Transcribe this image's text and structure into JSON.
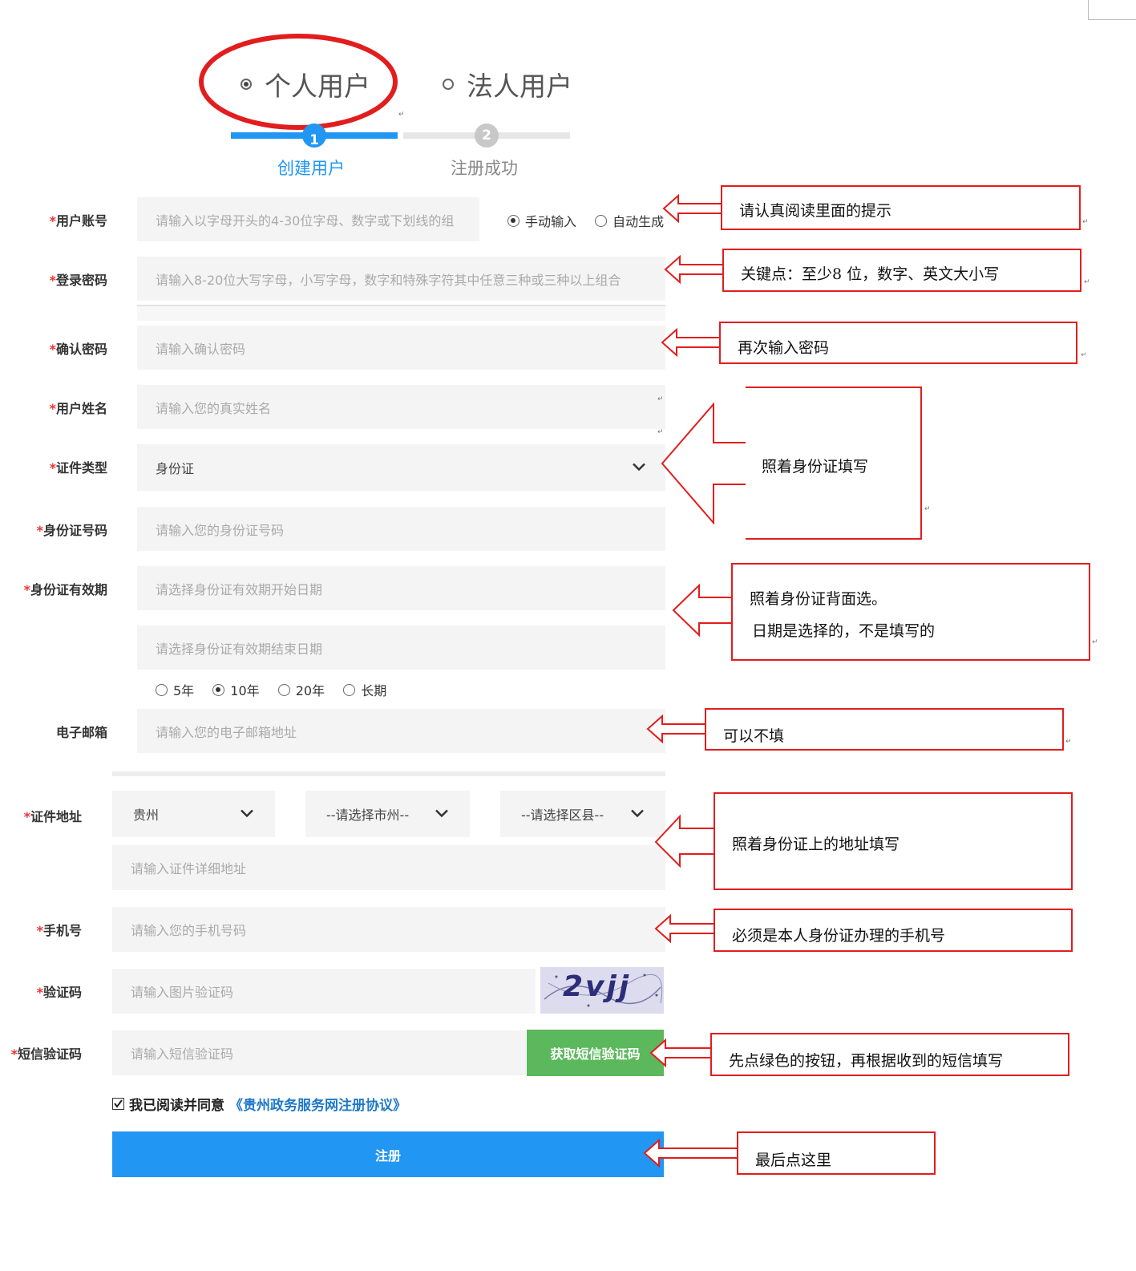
{
  "user_types": [
    {
      "label": "个人用户",
      "selected": true
    },
    {
      "label": "法人用户",
      "selected": false
    }
  ],
  "steps": [
    {
      "number": "1",
      "label": "创建用户",
      "active": true
    },
    {
      "number": "2",
      "label": "注册成功",
      "active": false
    }
  ],
  "form": {
    "account": {
      "label": "用户账号",
      "placeholder": "请输入以字母开头的4-30位字母、数字或下划线的组",
      "modes": [
        {
          "label": "手动输入",
          "selected": true
        },
        {
          "label": "自动生成",
          "selected": false
        }
      ]
    },
    "password": {
      "label": "登录密码",
      "placeholder": "请输入8-20位大写字母，小写字母，数字和特殊字符其中任意三种或三种以上组合"
    },
    "confirm": {
      "label": "确认密码",
      "placeholder": "请输入确认密码"
    },
    "name": {
      "label": "用户姓名",
      "placeholder": "请输入您的真实姓名"
    },
    "id_type": {
      "label": "证件类型",
      "value": "身份证"
    },
    "id_number": {
      "label": "身份证号码",
      "placeholder": "请输入您的身份证号码"
    },
    "validity": {
      "label": "身份证有效期",
      "start_placeholder": "请选择身份证有效期开始日期",
      "end_placeholder": "请选择身份证有效期结束日期",
      "options": [
        {
          "label": "5年",
          "selected": false
        },
        {
          "label": "10年",
          "selected": true
        },
        {
          "label": "20年",
          "selected": false
        },
        {
          "label": "长期",
          "selected": false
        }
      ]
    },
    "email": {
      "label": "电子邮箱",
      "placeholder": "请输入您的电子邮箱地址"
    },
    "address": {
      "label": "证件地址",
      "province": "贵州",
      "city": "--请选择市州--",
      "district": "--请选择区县--",
      "detail_placeholder": "请输入证件详细地址"
    },
    "phone": {
      "label": "手机号",
      "placeholder": "请输入您的手机号码"
    },
    "captcha": {
      "label": "验证码",
      "placeholder": "请输入图片验证码",
      "image_text": "2vjj"
    },
    "sms": {
      "label": "短信验证码",
      "placeholder": "请输入短信验证码",
      "button": "获取短信验证码"
    },
    "agreement": {
      "text": "我已阅读并同意",
      "link": "《贵州政务服务网注册协议》",
      "checked": true
    },
    "submit": "注册"
  },
  "annotations": [
    "请认真阅读里面的提示",
    "关键点：至少8 位，数字、英文大小写",
    "再次输入密码",
    "照着身份证填写",
    "照着身份证背面选。",
    "日期是选择的，不是填写的",
    "可以不填",
    "照着身份证上的地址填写",
    "必须是本人身份证办理的手机号",
    "先点绿色的按钮，再根据收到的短信填写",
    "最后点这里"
  ],
  "colors": {
    "annotation_red": "#e21d1d",
    "step_blue": "#2196f3",
    "sms_green": "#5cb85c",
    "field_bg": "#f4f4f4"
  }
}
